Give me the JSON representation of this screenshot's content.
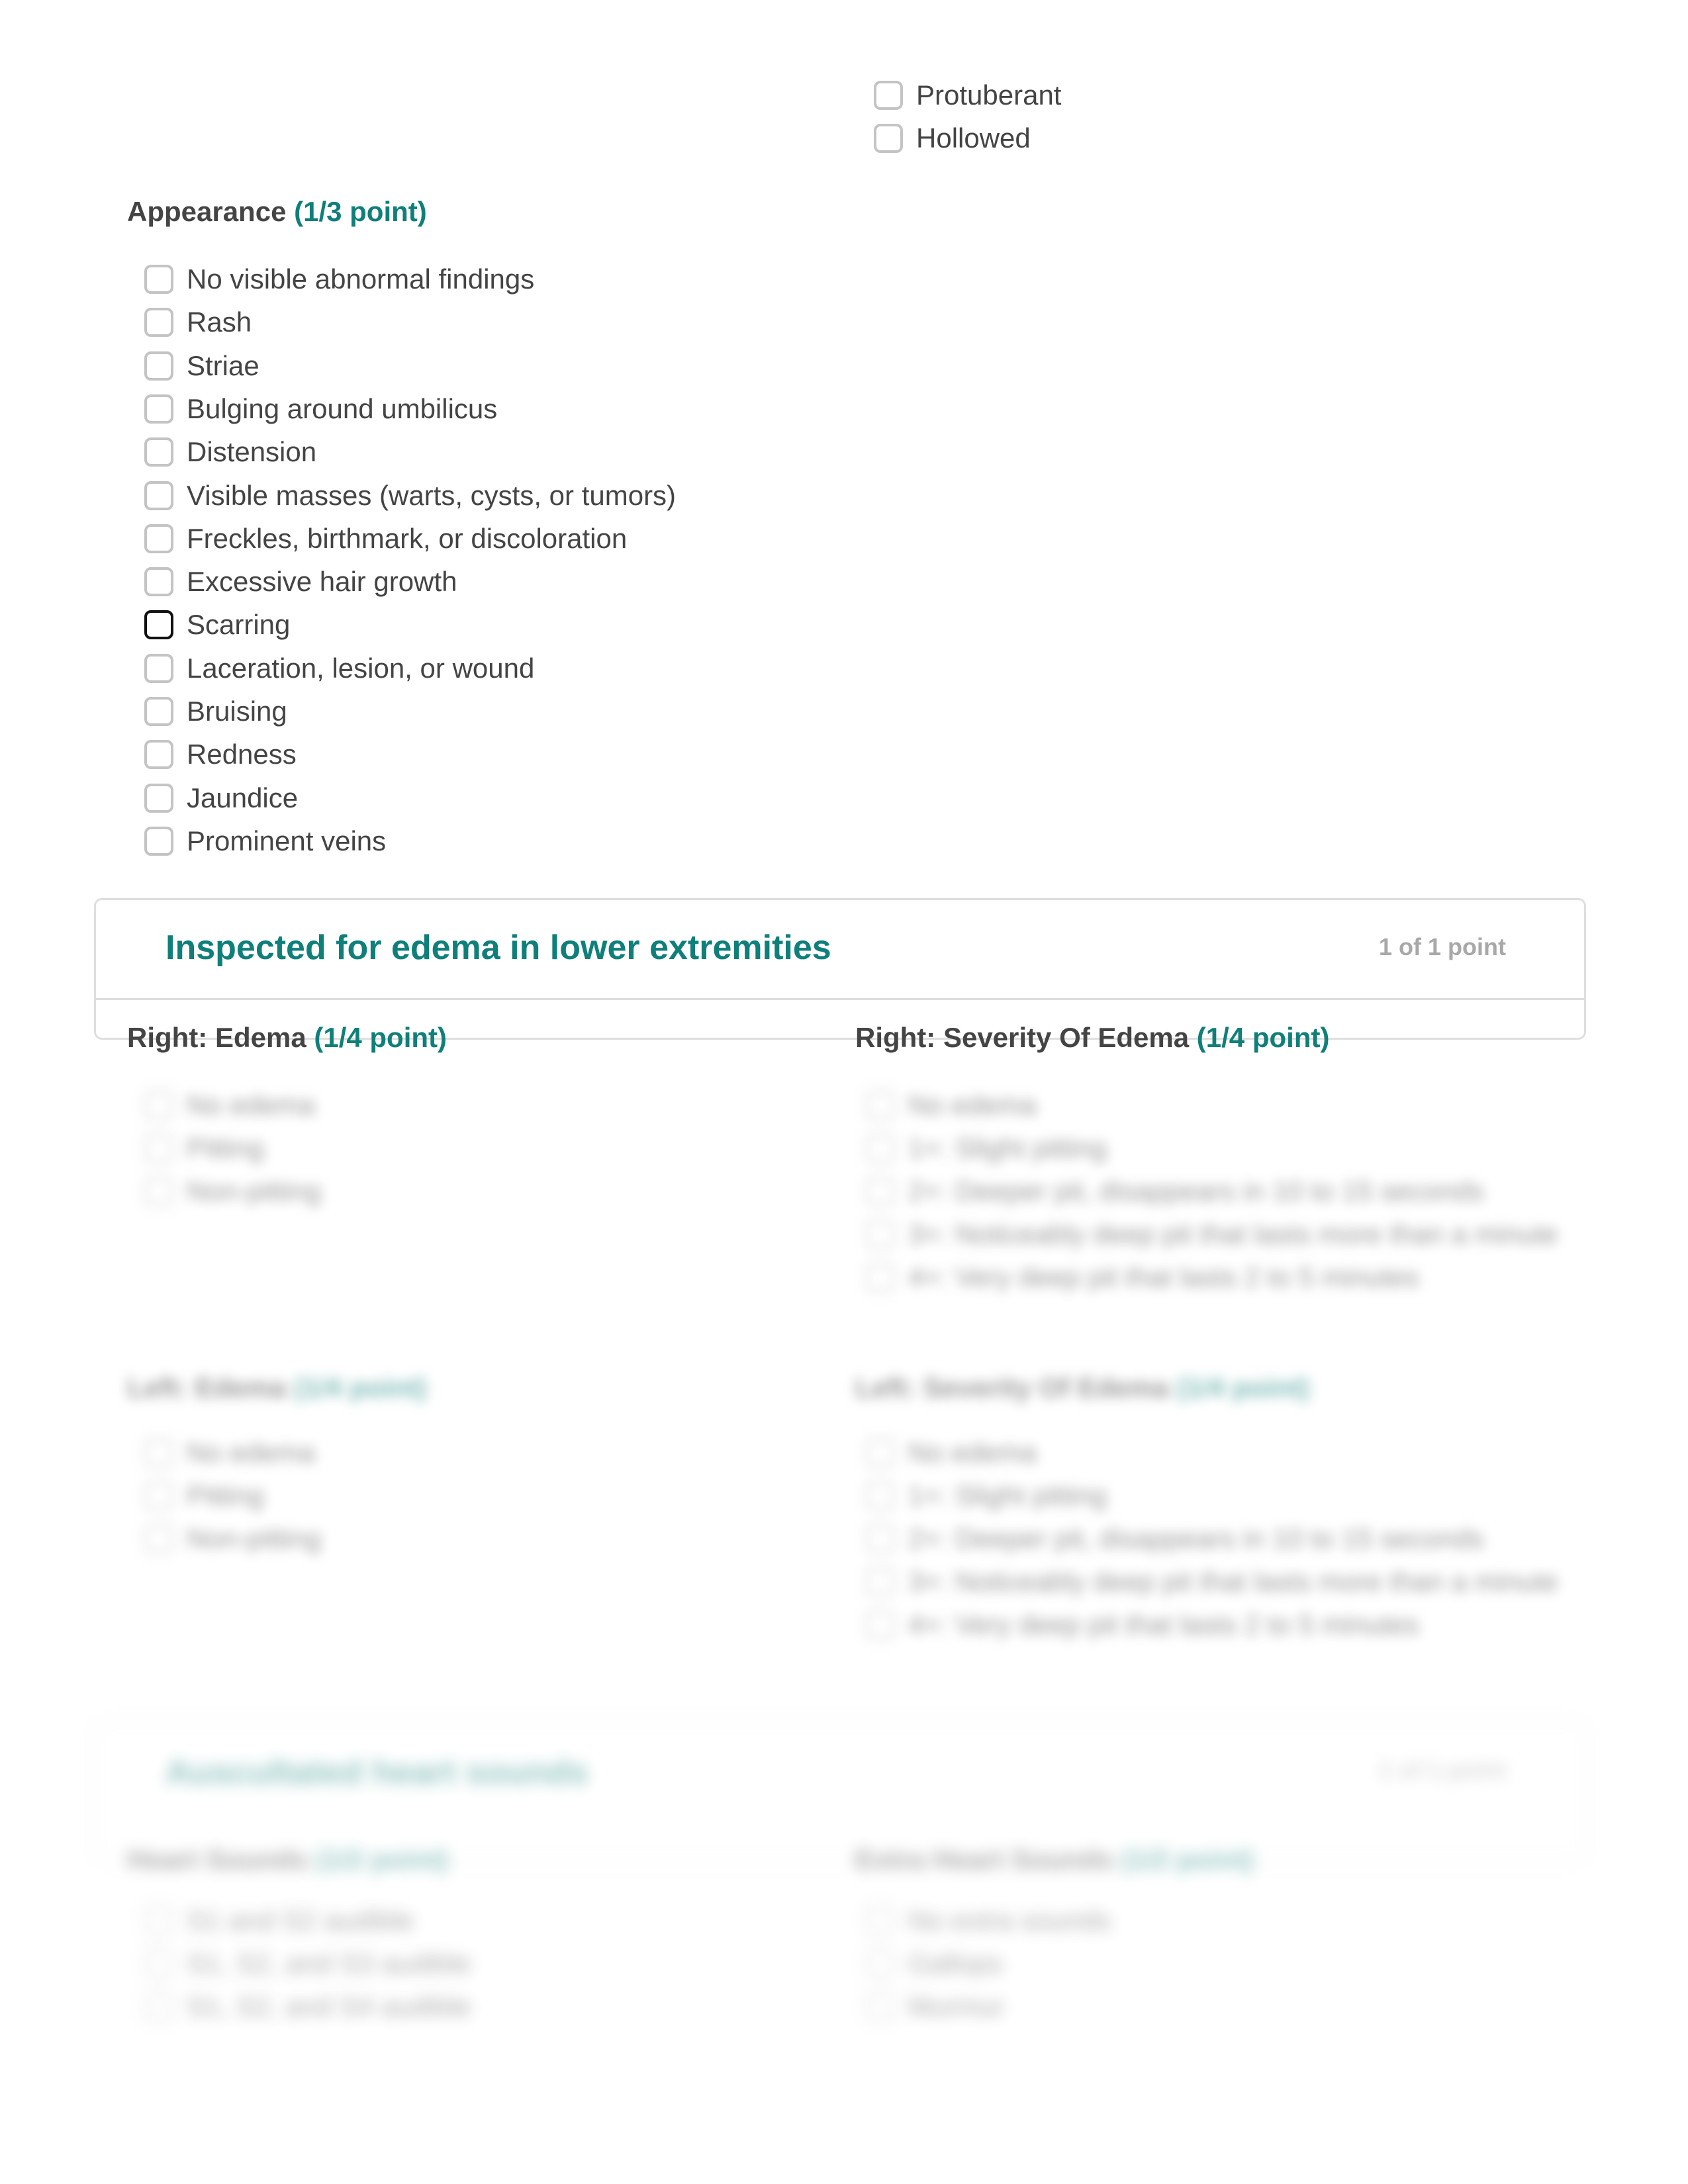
{
  "contour_options": [
    "Protuberant",
    "Hollowed"
  ],
  "appearance": {
    "label": "Appearance",
    "points": "(1/3 point)",
    "options": [
      "No visible abnormal findings",
      "Rash",
      "Striae",
      "Bulging around umbilicus",
      "Distension",
      "Visible masses (warts, cysts, or tumors)",
      "Freckles, birthmark, or discoloration",
      "Excessive hair growth",
      "Scarring",
      "Laceration, lesion, or wound",
      "Bruising",
      "Redness",
      "Jaundice",
      "Prominent veins"
    ]
  },
  "edema_section": {
    "title": "Inspected for edema in lower extremities",
    "score": "1 of 1 point",
    "right_edema": {
      "label": "Right: Edema",
      "points": "(1/4 point)",
      "options": [
        "No edema",
        "Pitting",
        "Non-pitting"
      ]
    },
    "right_severity": {
      "label": "Right: Severity Of Edema",
      "points": "(1/4 point)",
      "options": [
        "No edema",
        "1+: Slight pitting",
        "2+: Deeper pit, disappears in 10 to 15 seconds",
        "3+: Noticeably deep pit that lasts more than a minute",
        "4+: Very deep pit that lasts 2 to 5 minutes"
      ]
    },
    "left_edema": {
      "label": "Left: Edema",
      "points": "(1/4 point)",
      "options": [
        "No edema",
        "Pitting",
        "Non-pitting"
      ]
    },
    "left_severity": {
      "label": "Left: Severity Of Edema",
      "points": "(1/4 point)",
      "options": [
        "No edema",
        "1+: Slight pitting",
        "2+: Deeper pit, disappears in 10 to 15 seconds",
        "3+: Noticeably deep pit that lasts more than a minute",
        "4+: Very deep pit that lasts 2 to 5 minutes"
      ]
    }
  },
  "heart_section": {
    "title": "Auscultated heart sounds",
    "score": "1 of 1 point",
    "heart_sounds": {
      "label": "Heart Sounds",
      "points": "(1/2 point)",
      "options": [
        "S1 and S2 audible",
        "S1, S2, and S3 audible",
        "S1, S2, and S4 audible"
      ]
    },
    "extra_sounds": {
      "label": "Extra Heart Sounds",
      "points": "(1/2 point)",
      "options": [
        "No extra sounds",
        "Gallops",
        "Murmur"
      ]
    }
  }
}
